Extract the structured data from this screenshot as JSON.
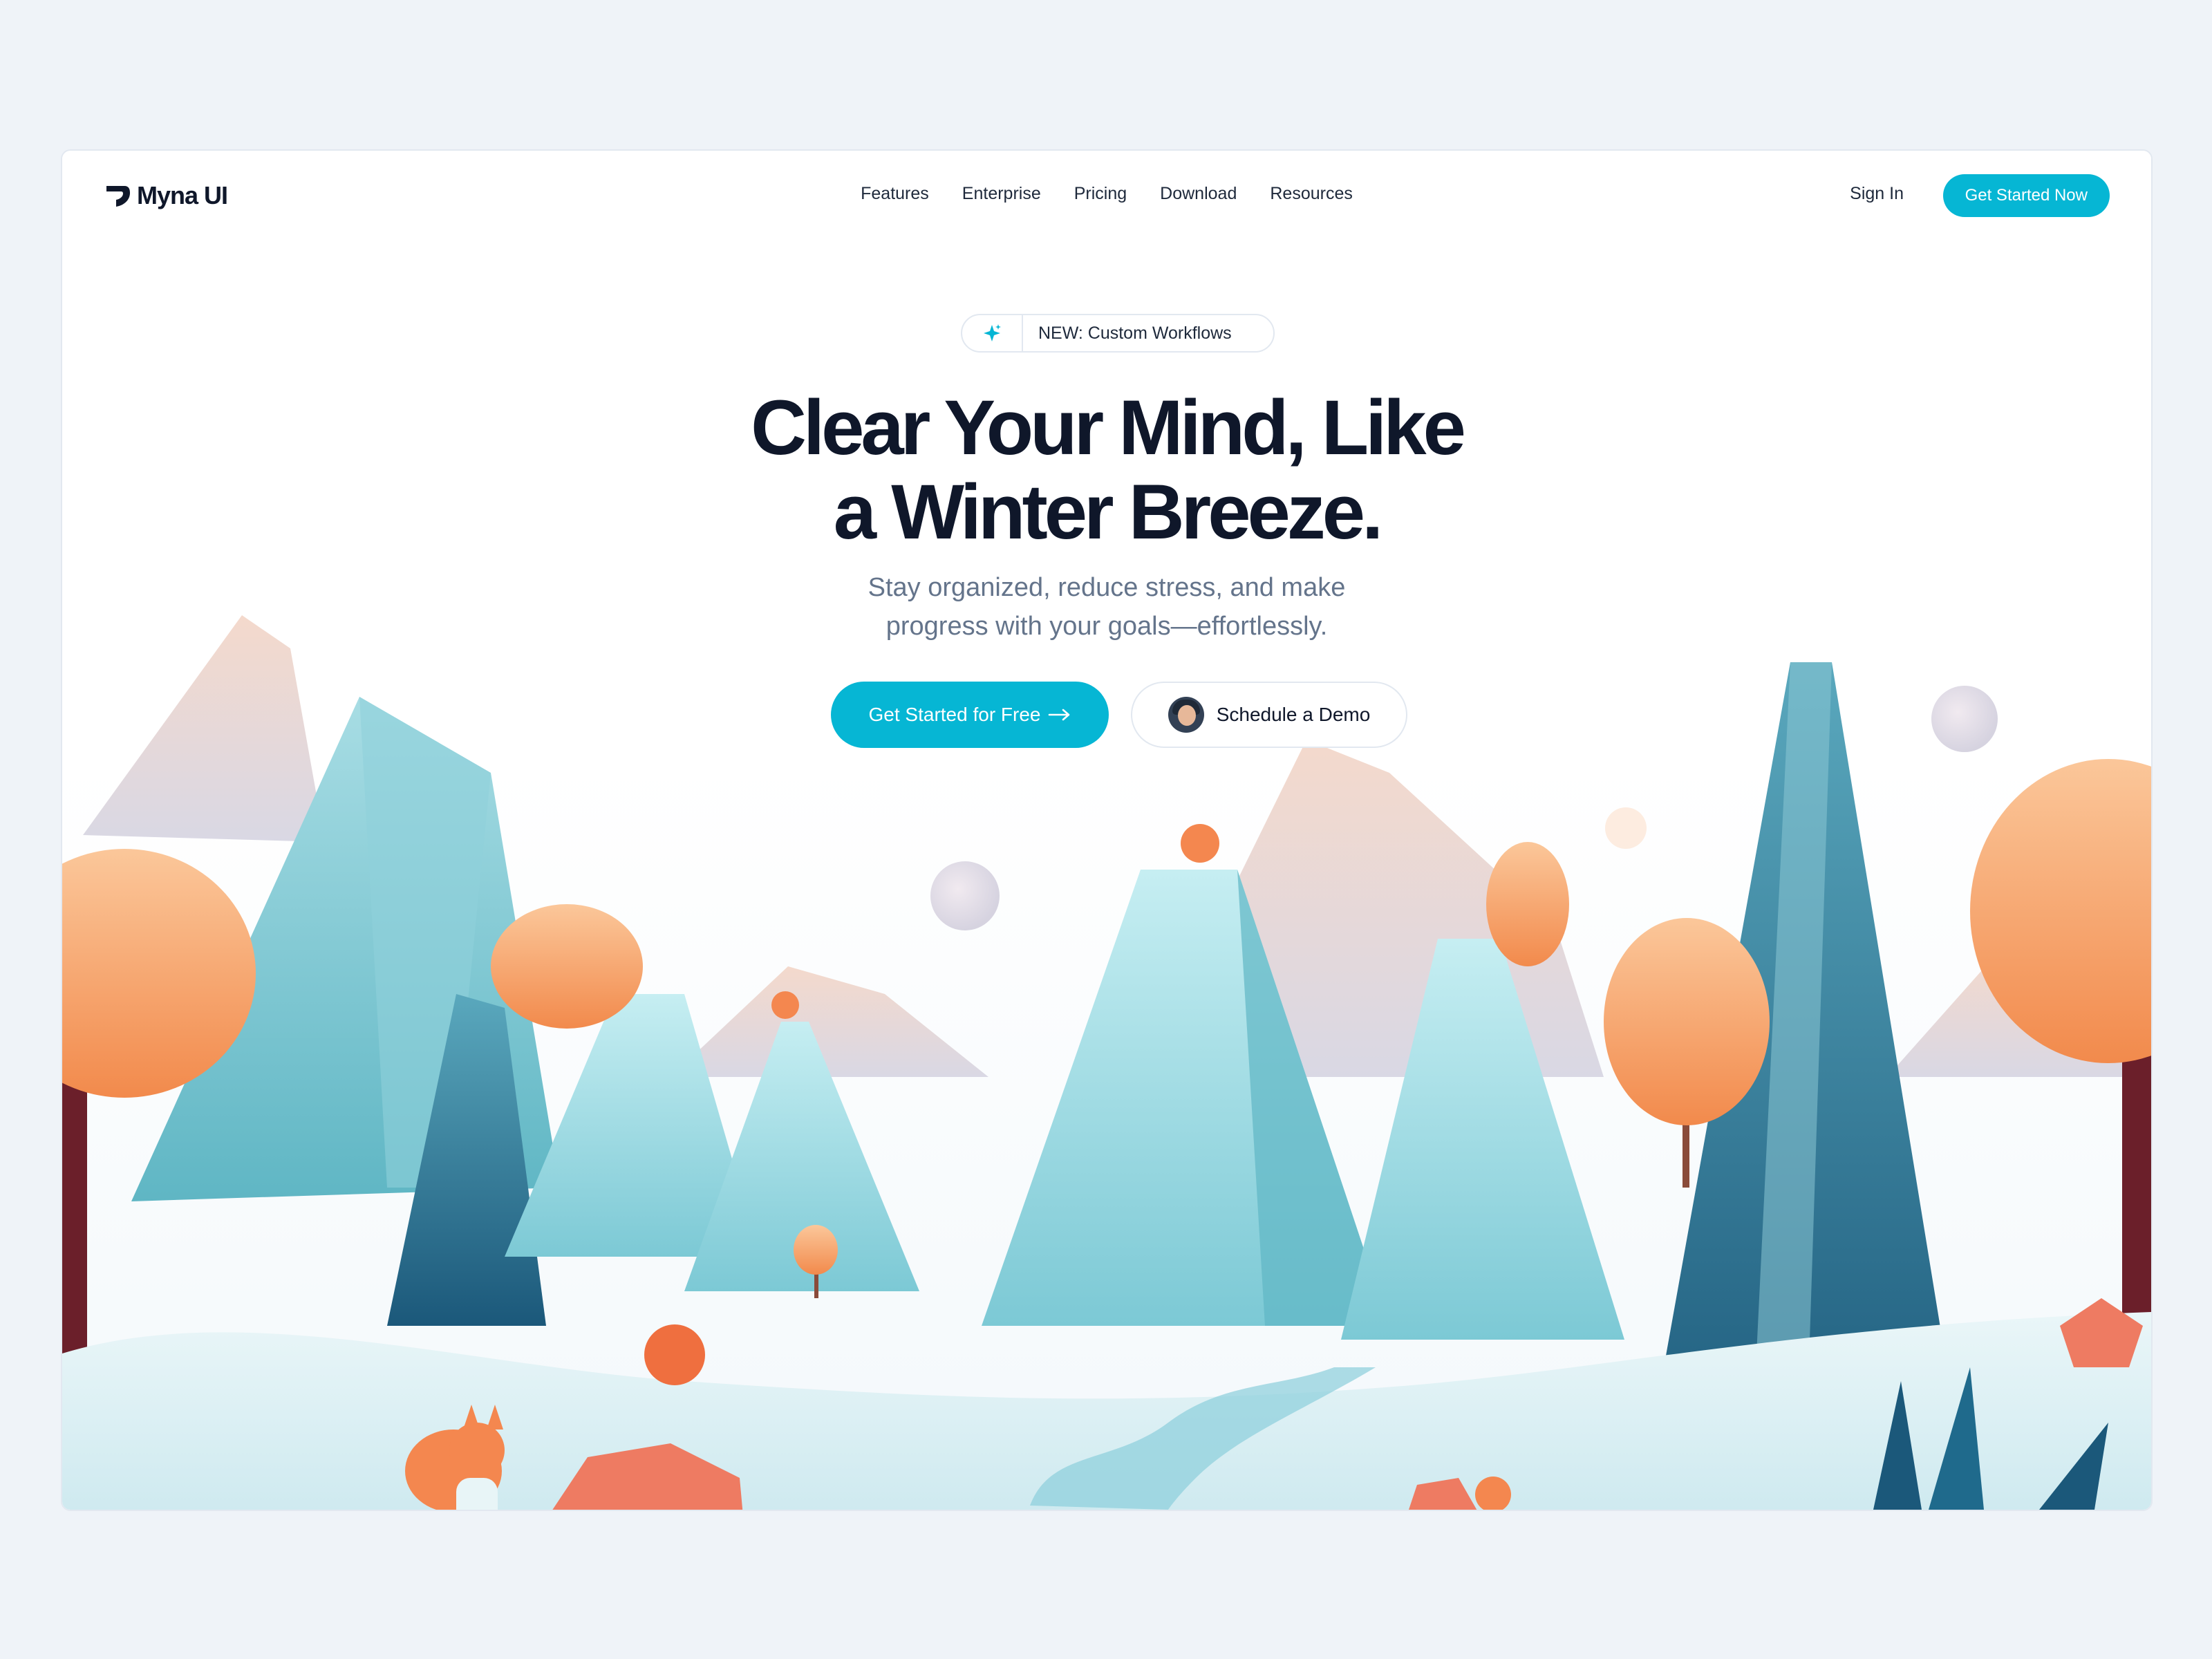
{
  "brand": {
    "name": "Myna UI"
  },
  "nav": {
    "items": [
      "Features",
      "Enterprise",
      "Pricing",
      "Download",
      "Resources"
    ],
    "sign_in": "Sign In",
    "cta": "Get Started Now"
  },
  "hero": {
    "badge": {
      "icon": "sparkle-icon",
      "text": "NEW: Custom Workflows"
    },
    "headline_line1": "Clear Your Mind, Like",
    "headline_line2": "a Winter Breeze.",
    "subhead_line1": "Stay organized, reduce stress, and make",
    "subhead_line2": "progress with your goals—effortlessly.",
    "primary_cta": "Get Started for Free",
    "primary_cta_icon": "arrow-right-icon",
    "secondary_cta": "Schedule a Demo",
    "secondary_cta_icon": "avatar"
  },
  "colors": {
    "accent": "#06b6d4",
    "text": "#0f172a",
    "muted": "#64748b",
    "page_bg": "#eff3f8"
  }
}
